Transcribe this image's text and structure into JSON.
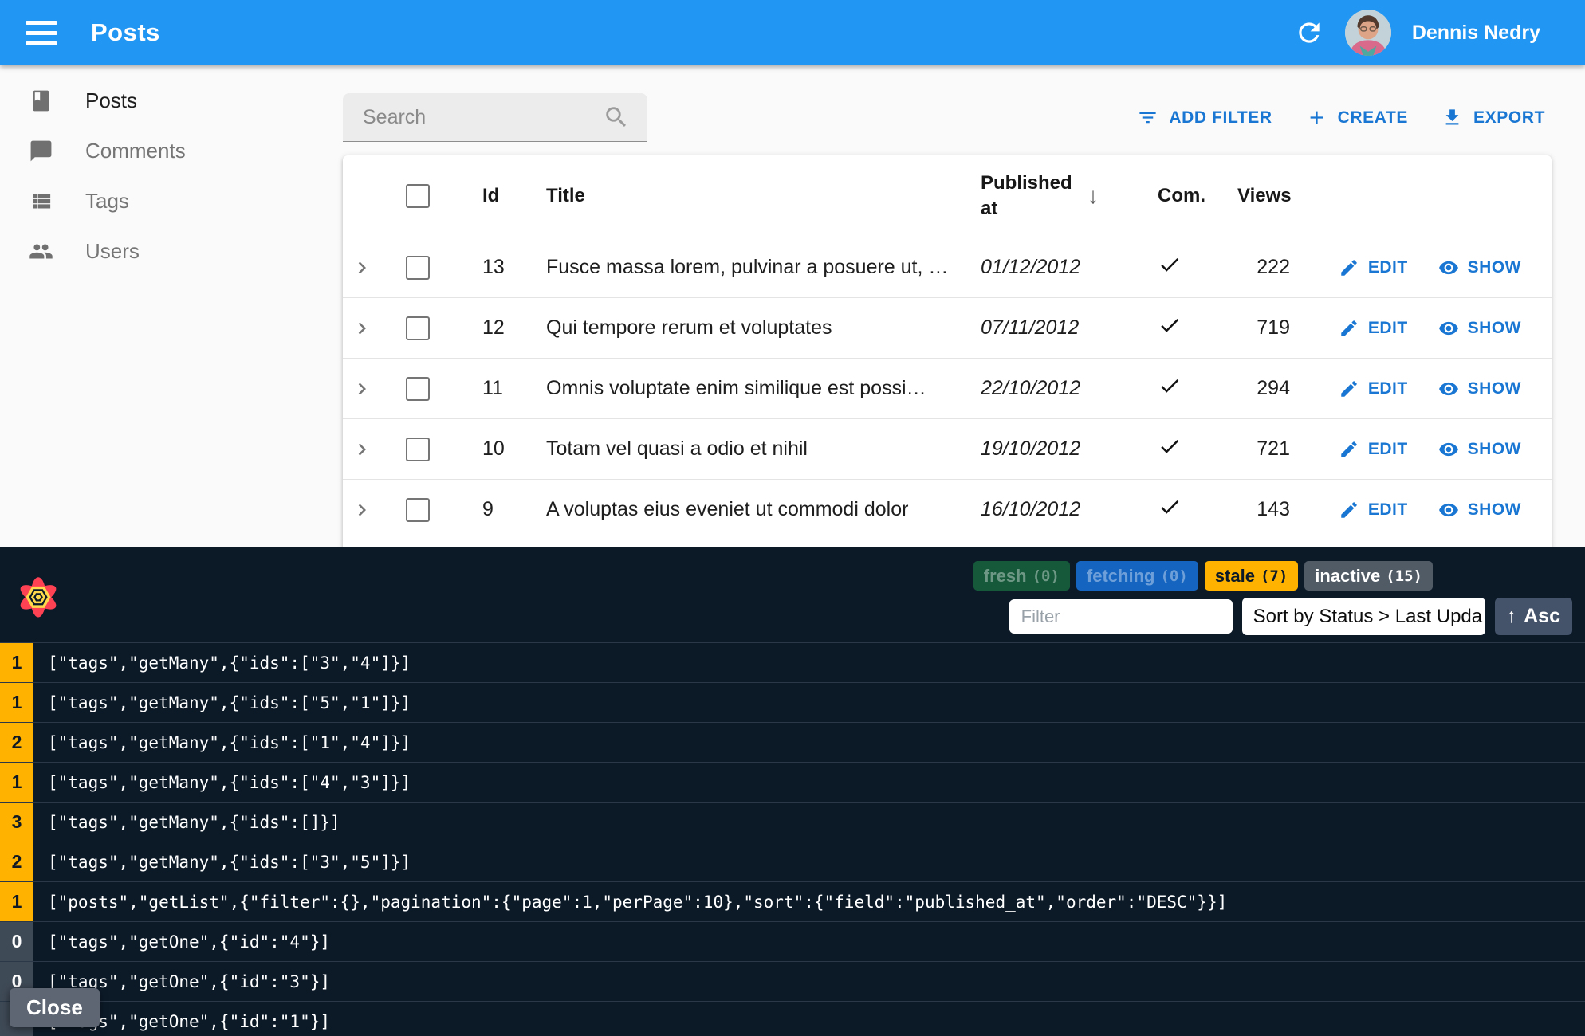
{
  "app_bar": {
    "title": "Posts",
    "user_name": "Dennis Nedry"
  },
  "sidebar": {
    "items": [
      {
        "label": "Posts"
      },
      {
        "label": "Comments"
      },
      {
        "label": "Tags"
      },
      {
        "label": "Users"
      }
    ]
  },
  "toolbar": {
    "search_placeholder": "Search",
    "add_filter_label": "ADD FILTER",
    "create_label": "CREATE",
    "export_label": "EXPORT"
  },
  "table": {
    "headers": {
      "id": "Id",
      "title": "Title",
      "published_at": "Published at",
      "com": "Com.",
      "views": "Views"
    },
    "sort_arrow": "↓",
    "edit_label": "EDIT",
    "show_label": "SHOW",
    "rows": [
      {
        "id": "13",
        "title": "Fusce massa lorem, pulvinar a posuere ut, …",
        "published_at": "01/12/2012",
        "commentable": true,
        "views": "222"
      },
      {
        "id": "12",
        "title": "Qui tempore rerum et voluptates",
        "published_at": "07/11/2012",
        "commentable": true,
        "views": "719"
      },
      {
        "id": "11",
        "title": "Omnis voluptate enim similique est possi…",
        "published_at": "22/10/2012",
        "commentable": true,
        "views": "294"
      },
      {
        "id": "10",
        "title": "Totam vel quasi a odio et nihil",
        "published_at": "19/10/2012",
        "commentable": true,
        "views": "721"
      },
      {
        "id": "9",
        "title": "A voluptas eius eveniet ut commodi dolor",
        "published_at": "16/10/2012",
        "commentable": true,
        "views": "143"
      }
    ]
  },
  "devtools": {
    "badges": [
      {
        "label": "fresh",
        "count": "(0)",
        "state": "fresh"
      },
      {
        "label": "fetching",
        "count": "(0)",
        "state": "fetching"
      },
      {
        "label": "stale",
        "count": "(7)",
        "state": "stale"
      },
      {
        "label": "inactive",
        "count": "(15)",
        "state": "inactive"
      }
    ],
    "filter_placeholder": "Filter",
    "sort_value": "Sort by Status > Last Upda",
    "asc_arrow": "↑",
    "asc_label": "Asc",
    "close_label": "Close",
    "queries": [
      {
        "count": "1",
        "state": "stale",
        "key": "[\"tags\",\"getMany\",{\"ids\":[\"3\",\"4\"]}]"
      },
      {
        "count": "1",
        "state": "stale",
        "key": "[\"tags\",\"getMany\",{\"ids\":[\"5\",\"1\"]}]"
      },
      {
        "count": "2",
        "state": "stale",
        "key": "[\"tags\",\"getMany\",{\"ids\":[\"1\",\"4\"]}]"
      },
      {
        "count": "1",
        "state": "stale",
        "key": "[\"tags\",\"getMany\",{\"ids\":[\"4\",\"3\"]}]"
      },
      {
        "count": "3",
        "state": "stale",
        "key": "[\"tags\",\"getMany\",{\"ids\":[]}]"
      },
      {
        "count": "2",
        "state": "stale",
        "key": "[\"tags\",\"getMany\",{\"ids\":[\"3\",\"5\"]}]"
      },
      {
        "count": "1",
        "state": "stale",
        "key": "[\"posts\",\"getList\",{\"filter\":{},\"pagination\":{\"page\":1,\"perPage\":10},\"sort\":{\"field\":\"published_at\",\"order\":\"DESC\"}}]"
      },
      {
        "count": "0",
        "state": "inactive",
        "key": "[\"tags\",\"getOne\",{\"id\":\"4\"}]"
      },
      {
        "count": "0",
        "state": "inactive",
        "key": "[\"tags\",\"getOne\",{\"id\":\"3\"}]"
      },
      {
        "count": "0",
        "state": "inactive",
        "key": "[\"tags\",\"getOne\",{\"id\":\"1\"}]"
      }
    ]
  },
  "colors": {
    "app_bar_blue": "#2196f3",
    "accent_blue": "#1976d2",
    "stale_amber": "#ffb200",
    "inactive_grey": "#3f4a57",
    "fresh_green": "#15593a",
    "fetching_blue": "#1565c0",
    "devtools_bg": "#0c1a28",
    "logo_red": "#ff4154",
    "logo_yellow": "#ffd94c"
  }
}
